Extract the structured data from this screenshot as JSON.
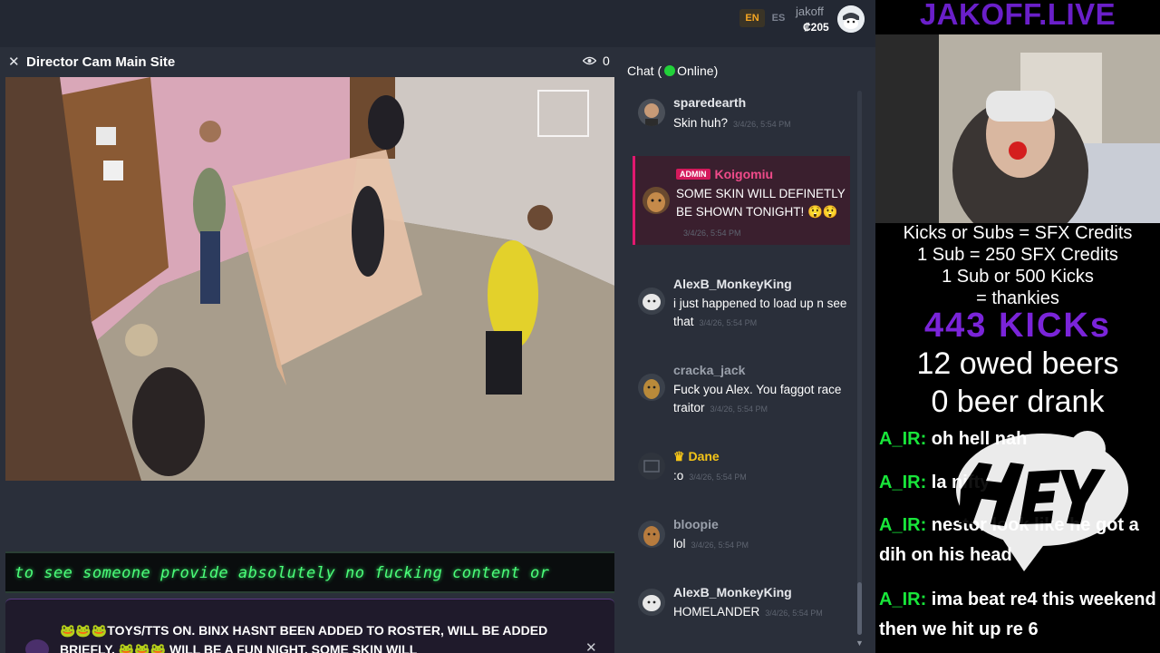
{
  "topbar": {
    "lang_en": "EN",
    "lang_es": "ES",
    "username": "jakoff",
    "balance": "₡205"
  },
  "player": {
    "title": "Director Cam Main Site",
    "viewer_count": "0"
  },
  "ticker": {
    "text": "to see someone provide absolutely no fucking content or"
  },
  "announcement": {
    "text": "🐸🐸🐸TOYS/TTS ON. BINX HASNT BEEN ADDED TO ROSTER, WILL BE ADDED BRIEFLY. 🐸🐸🐸 WILL BE A FUN NIGHT. SOME SKIN WILL"
  },
  "chat": {
    "label": "Chat (",
    "status": "Online)",
    "messages": [
      {
        "user": "sparedearth",
        "text": "Skin huh?",
        "time": "3/4/26, 5:54 PM"
      },
      {
        "user": "Koigomiu",
        "badge": "ADMIN",
        "text": "SOME SKIN WILL DEFINETLY BE SHOWN TONIGHT! 😲😲",
        "time": "3/4/26, 5:54 PM"
      },
      {
        "user": "AlexB_MonkeyKing",
        "text": "i just happened to load up n see that",
        "time": "3/4/26, 5:54 PM"
      },
      {
        "user": "cracka_jack",
        "text": "Fuck you Alex. You faggot race traitor",
        "time": "3/4/26, 5:54 PM"
      },
      {
        "user": "Dane",
        "crown": "♛",
        "text": ":o",
        "time": "3/4/26, 5:54 PM"
      },
      {
        "user": "bloopie",
        "text": "lol",
        "time": "3/4/26, 5:54 PM"
      },
      {
        "user": "AlexB_MonkeyKing",
        "text": "HOMELANDER",
        "time": "3/4/26, 5:54 PM"
      }
    ]
  },
  "overlay": {
    "title": "JAKOFF.LIVE",
    "lines": [
      "Kicks or Subs = SFX Credits",
      "1 Sub = 250 SFX Credits",
      "1 Sub or 500 Kicks",
      "= thankies"
    ],
    "kicks": "443 KICKs",
    "owed_beers": "12 owed beers",
    "beer_drank": "0 beer drank",
    "chat": [
      {
        "name": "A_IR:",
        "text": "oh hell nah"
      },
      {
        "name": "A_IR:",
        "text": "la nifty"
      },
      {
        "name": "A_IR:",
        "text": "nestor look like he got a dih on his head"
      },
      {
        "name": "A_IR:",
        "text": "ima beat re4 this weekend then we hit up re 6"
      }
    ]
  },
  "colors": {
    "accent_green": "#22d13a",
    "admin_pink": "#e2186f",
    "overlay_purple": "#6a1fc9",
    "ticker_green": "#4cff7a"
  }
}
